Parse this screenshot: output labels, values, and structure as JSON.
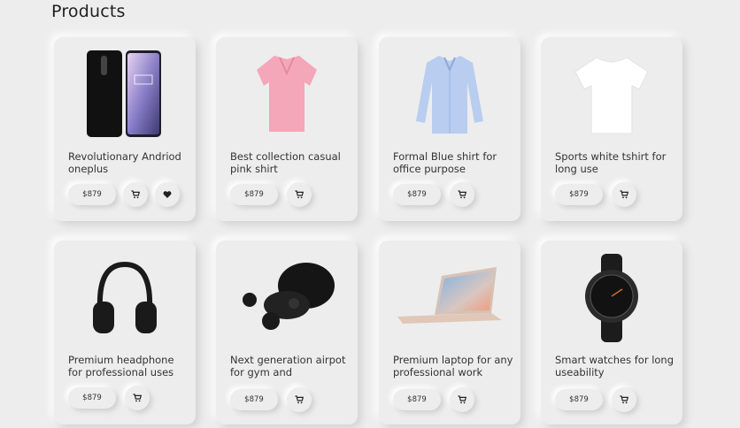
{
  "page": {
    "title": "Products"
  },
  "products": [
    {
      "name": "Revolutionary Andriod oneplus",
      "price": "$879",
      "image": "smartphone-image",
      "has_wishlist": true
    },
    {
      "name": "Best collection casual pink shirt",
      "price": "$879",
      "image": "pink-polo-shirt-image",
      "has_wishlist": false
    },
    {
      "name": "Formal  Blue shirt for office purpose",
      "price": "$879",
      "image": "blue-formal-shirt-image",
      "has_wishlist": false
    },
    {
      "name": "Sports white tshirt for long use",
      "price": "$879",
      "image": "white-tshirt-image",
      "has_wishlist": false
    },
    {
      "name": "Premium headphone for professional uses",
      "price": "$879",
      "image": "headphones-image",
      "has_wishlist": false
    },
    {
      "name": "Next generation airpot for gym and",
      "price": "$879",
      "image": "earbuds-image",
      "has_wishlist": false
    },
    {
      "name": "Premium laptop for any professional work",
      "price": "$879",
      "image": "laptop-image",
      "has_wishlist": false
    },
    {
      "name": "Smart watches for long useability",
      "price": "$879",
      "image": "smartwatch-image",
      "has_wishlist": false
    }
  ],
  "icons": {
    "cart": "cart-icon",
    "wishlist": "heart-icon"
  },
  "colors": {
    "background": "#ededed",
    "shadow_dark": "#d2d2d2",
    "shadow_light": "#ffffff"
  }
}
